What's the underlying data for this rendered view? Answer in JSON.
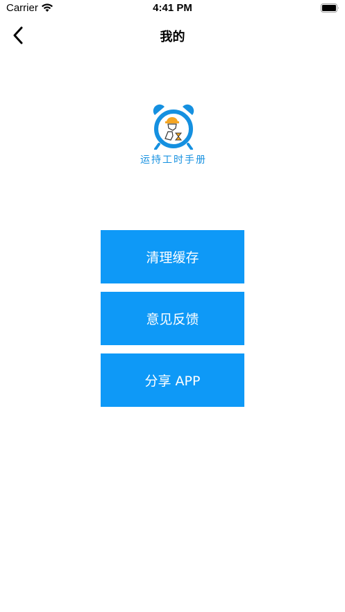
{
  "status_bar": {
    "carrier": "Carrier",
    "time": "4:41 PM",
    "wifi_icon": "wifi-icon",
    "battery_icon": "battery-icon"
  },
  "nav": {
    "back_icon": "chevron-left-icon",
    "title": "我的"
  },
  "logo": {
    "icon": "alarm-clock-worker-icon",
    "text": "运持工时手册",
    "color": "#1590e0",
    "accent_color": "#f5a623"
  },
  "menu": {
    "clear_cache_label": "清理缓存",
    "feedback_label": "意见反馈",
    "share_label": "分享 APP",
    "button_color": "#0e99f7"
  }
}
